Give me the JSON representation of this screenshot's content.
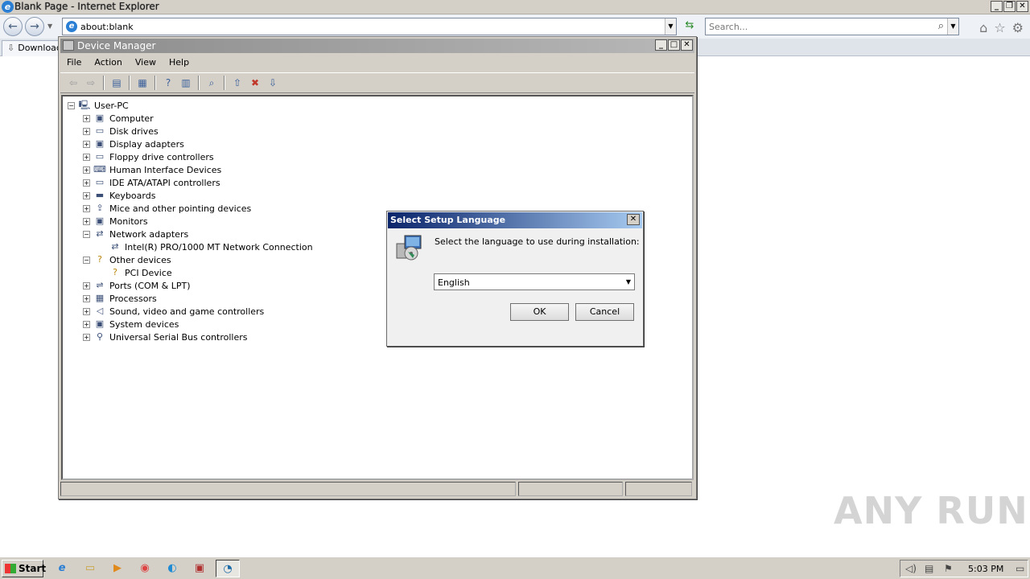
{
  "ie": {
    "title": "Blank Page - Internet Explorer",
    "address": "about:blank",
    "search_placeholder": "Search...",
    "tab_label": "Download"
  },
  "device_manager": {
    "title": "Device Manager",
    "menu": [
      "File",
      "Action",
      "View",
      "Help"
    ],
    "tree": [
      {
        "label": "User-PC",
        "level": 0,
        "expander": "−"
      },
      {
        "label": "Computer",
        "level": 1,
        "expander": "+"
      },
      {
        "label": "Disk drives",
        "level": 1,
        "expander": "+"
      },
      {
        "label": "Display adapters",
        "level": 1,
        "expander": "+"
      },
      {
        "label": "Floppy drive controllers",
        "level": 1,
        "expander": "+"
      },
      {
        "label": "Human Interface Devices",
        "level": 1,
        "expander": "+"
      },
      {
        "label": "IDE ATA/ATAPI controllers",
        "level": 1,
        "expander": "+"
      },
      {
        "label": "Keyboards",
        "level": 1,
        "expander": "+"
      },
      {
        "label": "Mice and other pointing devices",
        "level": 1,
        "expander": "+"
      },
      {
        "label": "Monitors",
        "level": 1,
        "expander": "+"
      },
      {
        "label": "Network adapters",
        "level": 1,
        "expander": "−"
      },
      {
        "label": "Intel(R) PRO/1000 MT Network Connection",
        "level": 2,
        "expander": ""
      },
      {
        "label": "Other devices",
        "level": 1,
        "expander": "−"
      },
      {
        "label": "PCI Device",
        "level": 2,
        "expander": ""
      },
      {
        "label": "Ports (COM & LPT)",
        "level": 1,
        "expander": "+"
      },
      {
        "label": "Processors",
        "level": 1,
        "expander": "+"
      },
      {
        "label": "Sound, video and game controllers",
        "level": 1,
        "expander": "+"
      },
      {
        "label": "System devices",
        "level": 1,
        "expander": "+"
      },
      {
        "label": "Universal Serial Bus controllers",
        "level": 1,
        "expander": "+"
      }
    ]
  },
  "dialog": {
    "title": "Select Setup Language",
    "message": "Select the language to use during installation:",
    "selected_language": "English",
    "ok_label": "OK",
    "cancel_label": "Cancel"
  },
  "taskbar": {
    "start_label": "Start",
    "clock": "5:03 PM"
  },
  "watermark": "ANY RUN"
}
